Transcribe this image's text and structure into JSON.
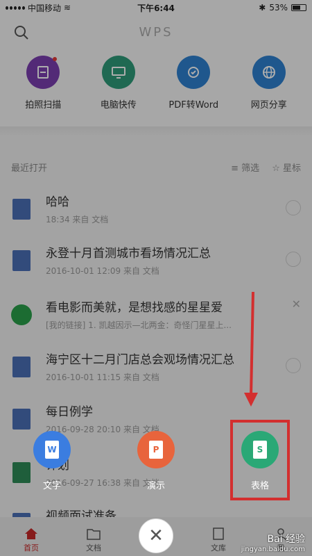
{
  "status_bar": {
    "carrier": "中国移动",
    "time": "下午6:44",
    "battery": "53%"
  },
  "header": {
    "logo": "WPS"
  },
  "tools": [
    {
      "label": "拍照扫描",
      "color": "#7b3fb0",
      "icon": "scan-icon"
    },
    {
      "label": "电脑快传",
      "color": "#2e9b7a",
      "icon": "monitor-icon"
    },
    {
      "label": "PDF转Word",
      "color": "#2f80d0",
      "icon": "convert-icon"
    },
    {
      "label": "网页分享",
      "color": "#2f80d0",
      "icon": "globe-icon"
    }
  ],
  "list_header": {
    "title": "最近打开",
    "filter": "筛选",
    "star": "星标"
  },
  "files": [
    {
      "name": "哈哈",
      "meta": "18:34 来自 文档",
      "type": "word"
    },
    {
      "name": "永登十月首测城市看场情况汇总",
      "meta": "2016-10-01 12:09 来自 文档",
      "type": "word"
    },
    {
      "name": "看电影而美就，是想找感的星星爱",
      "meta": "[我的链接] 1. 凯越因示—北两金：奇怪门星星上...",
      "type": "wechat"
    },
    {
      "name": "海宁区十二月门店总会观场情况汇总",
      "meta": "2016-10-01 11:15 来自 文档",
      "type": "word"
    },
    {
      "name": "每日例学",
      "meta": "2016-09-28 20:10 来自 文档",
      "type": "word"
    },
    {
      "name": "计划",
      "meta": "2016-09-27 16:38 来自 文档",
      "type": "excel"
    },
    {
      "name": "视频面试准备",
      "meta": "",
      "type": "word"
    }
  ],
  "create_menu": [
    {
      "label": "文字",
      "color": "#3b7de0",
      "letter": "W"
    },
    {
      "label": "演示",
      "color": "#e8643c",
      "letter": "P"
    },
    {
      "label": "表格",
      "color": "#2aa876",
      "letter": "S"
    }
  ],
  "tabs": [
    {
      "label": "首页"
    },
    {
      "label": "文档"
    },
    {
      "label": ""
    },
    {
      "label": "文库"
    },
    {
      "label": "我"
    }
  ],
  "watermark": {
    "main": "Bai 经验",
    "sub": "jingyan.baidu.com"
  }
}
